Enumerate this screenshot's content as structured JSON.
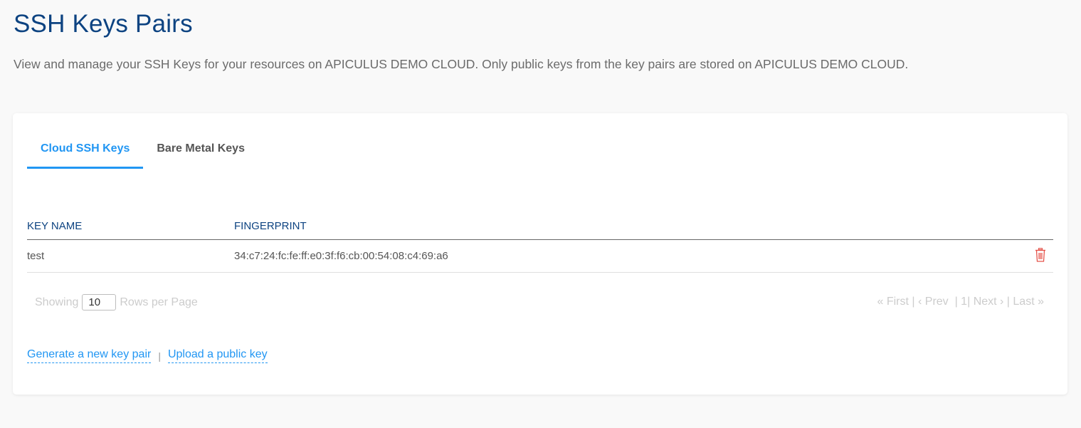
{
  "header": {
    "title": "SSH Keys Pairs",
    "description": "View and manage your SSH Keys for your resources on APICULUS DEMO CLOUD. Only public keys from the key pairs are stored on APICULUS DEMO CLOUD."
  },
  "tabs": [
    {
      "label": "Cloud SSH Keys",
      "active": true
    },
    {
      "label": "Bare Metal Keys",
      "active": false
    }
  ],
  "table": {
    "columns": [
      "KEY NAME",
      "FINGERPRINT"
    ],
    "rows": [
      {
        "key_name": "test",
        "fingerprint": "34:c7:24:fc:fe:ff:e0:3f:f6:cb:00:54:08:c4:69:a6",
        "action_icon": "trash-icon"
      }
    ]
  },
  "pagination": {
    "showing_label": "Showing",
    "rows_per_page_value": "10",
    "rows_per_page_label": "Rows per Page",
    "first": "« First",
    "prev": "‹ Prev",
    "current_page": "1",
    "next": "Next ›",
    "last": "Last »"
  },
  "actions": {
    "generate": "Generate a new key pair",
    "separator": "|",
    "upload": "Upload a public key"
  },
  "colors": {
    "title": "#0d4381",
    "accent": "#2196f3",
    "delete": "#e5534b"
  }
}
